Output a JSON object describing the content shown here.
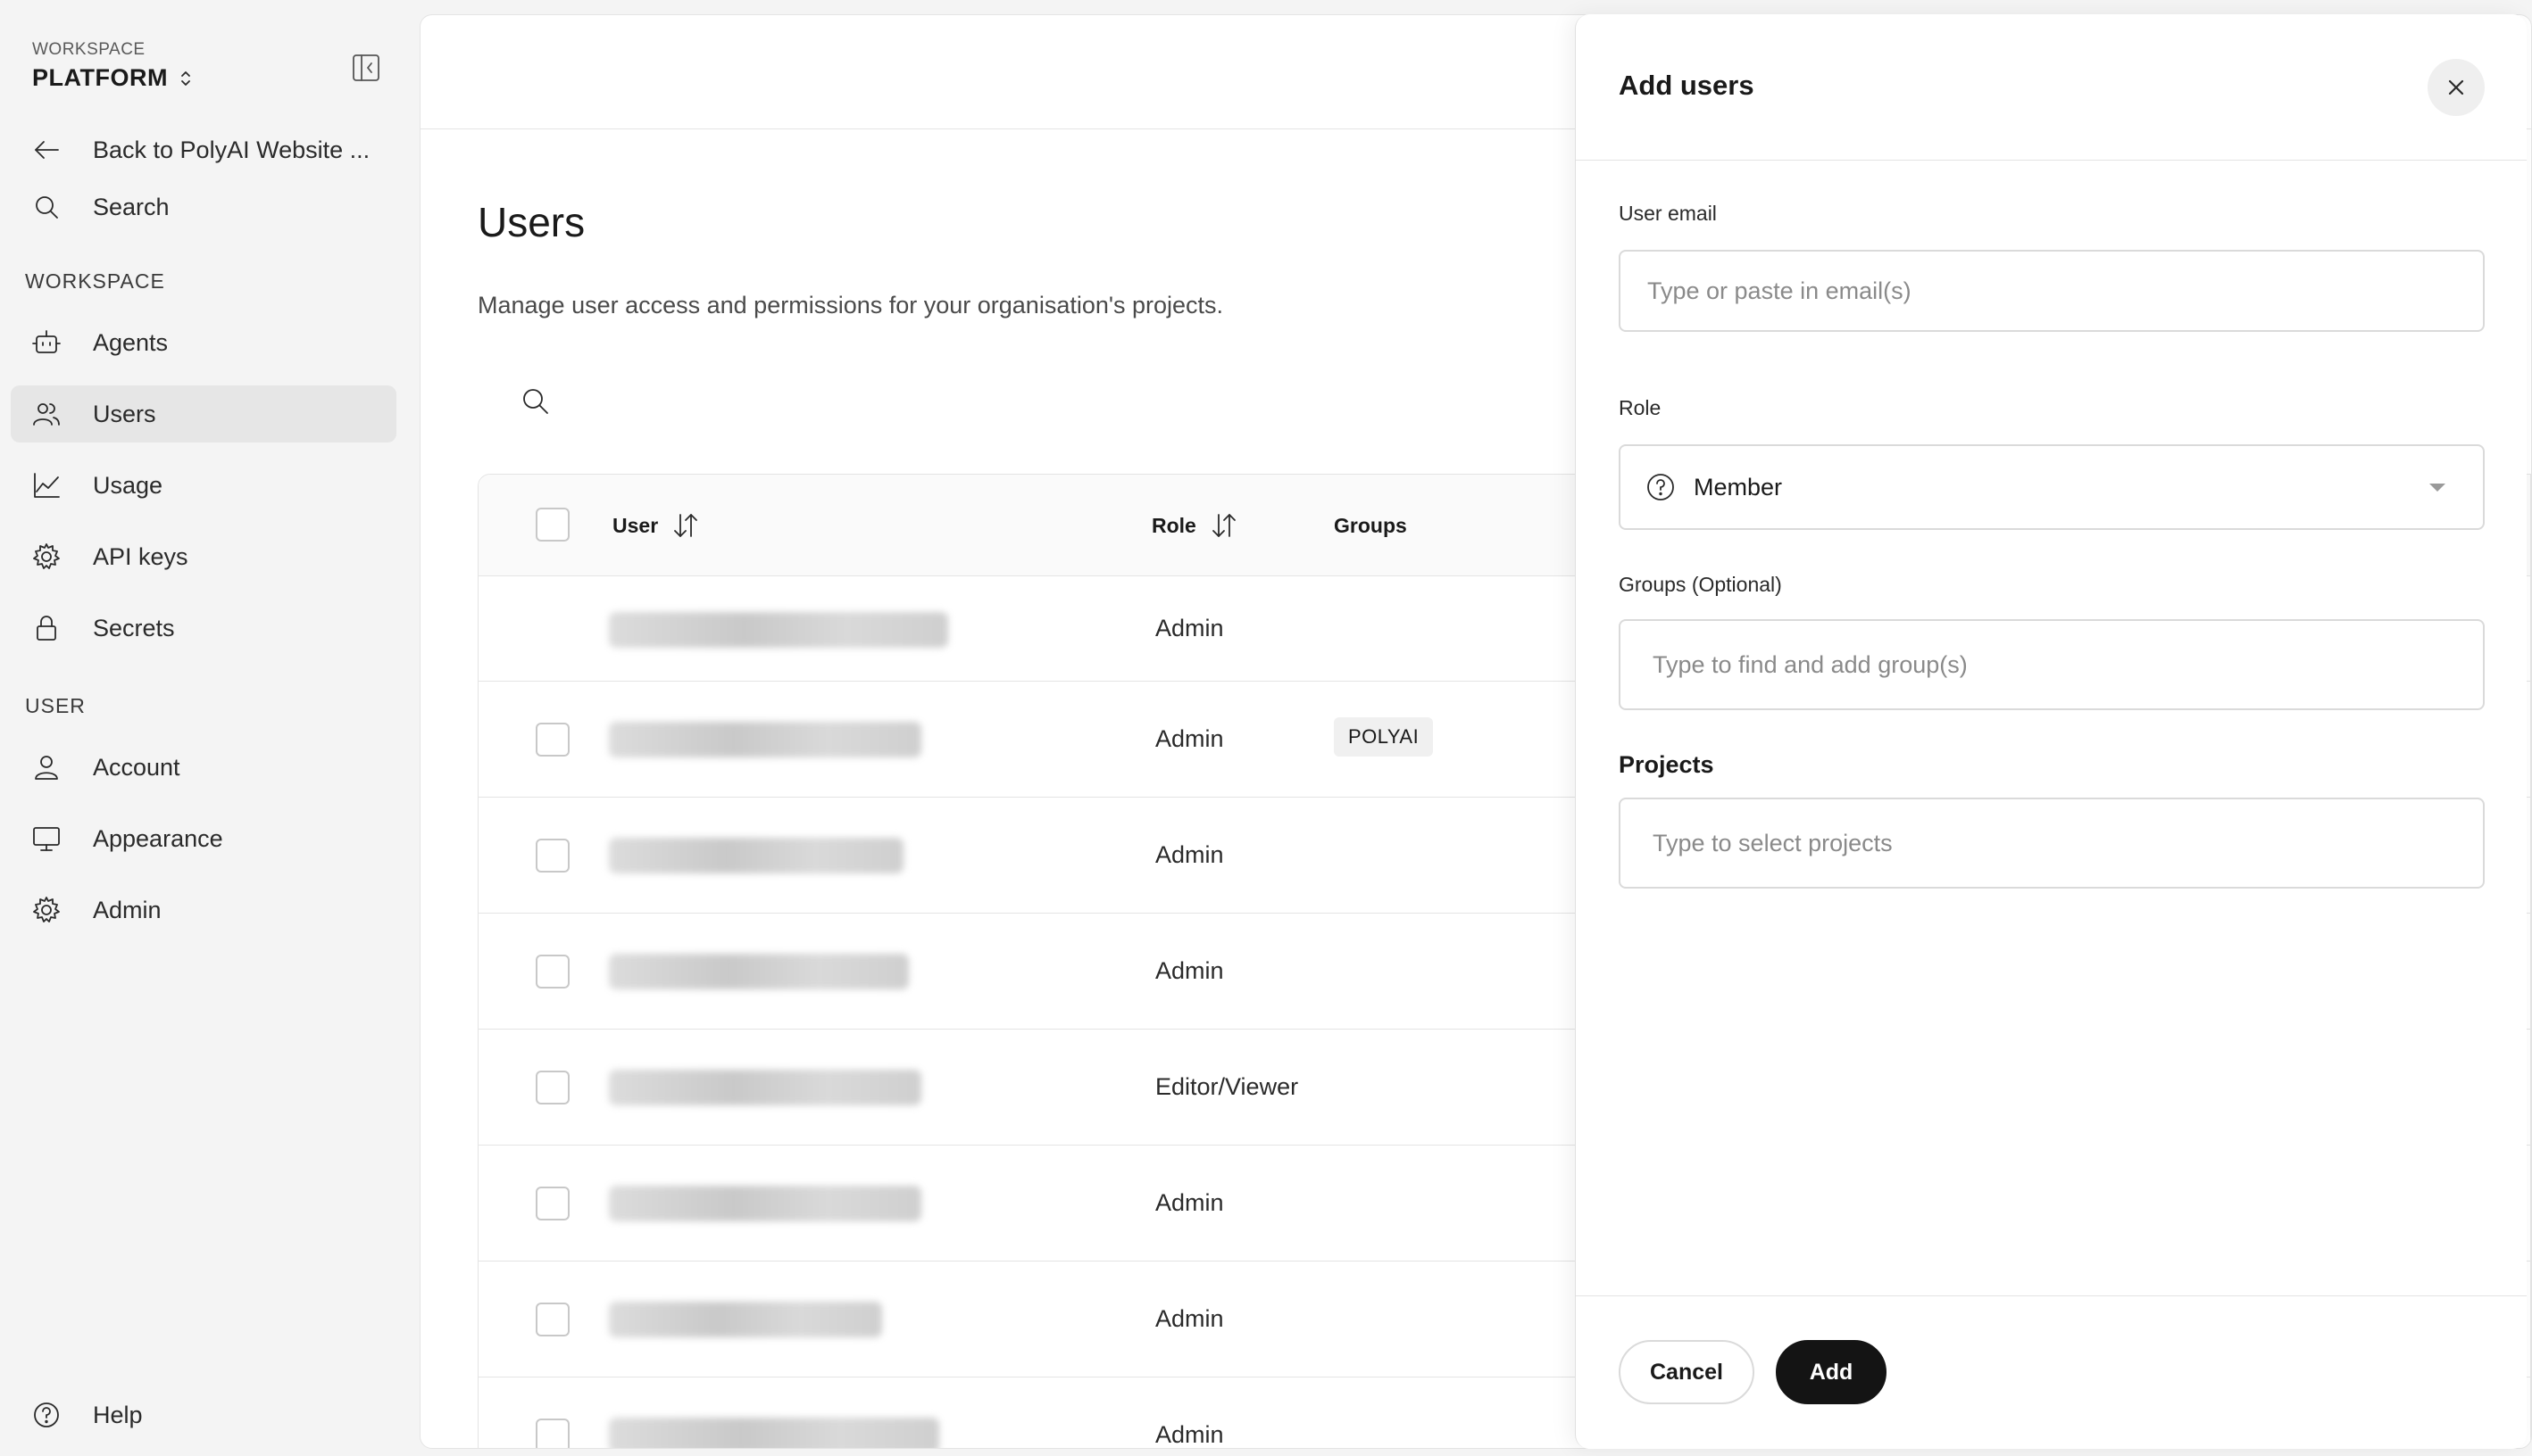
{
  "sidebar": {
    "workspace_label": "WORKSPACE",
    "workspace_name": "PLATFORM",
    "back_label": "Back to PolyAI Website ...",
    "search_label": "Search",
    "section_workspace": "WORKSPACE",
    "section_user": "USER",
    "workspace_items": [
      {
        "label": "Agents",
        "icon": "robot-icon"
      },
      {
        "label": "Users",
        "icon": "users-icon",
        "active": true
      },
      {
        "label": "Usage",
        "icon": "chart-line-icon"
      },
      {
        "label": "API keys",
        "icon": "gear-icon"
      },
      {
        "label": "Secrets",
        "icon": "lock-icon"
      }
    ],
    "user_items": [
      {
        "label": "Account",
        "icon": "person-icon"
      },
      {
        "label": "Appearance",
        "icon": "monitor-icon"
      },
      {
        "label": "Admin",
        "icon": "gear-icon"
      }
    ],
    "help_label": "Help"
  },
  "main": {
    "title": "Users",
    "subtitle": "Manage user access and permissions for your organisation's projects.",
    "table": {
      "columns": {
        "user": "User",
        "role": "Role",
        "groups": "Groups"
      },
      "rows": [
        {
          "role": "Admin",
          "group": ""
        },
        {
          "role": "Admin",
          "group": "POLYAI"
        },
        {
          "role": "Admin",
          "group": ""
        },
        {
          "role": "Admin",
          "group": ""
        },
        {
          "role": "Editor/Viewer",
          "group": ""
        },
        {
          "role": "Admin",
          "group": ""
        },
        {
          "role": "Admin",
          "group": ""
        },
        {
          "role": "Admin",
          "group": ""
        }
      ]
    }
  },
  "drawer": {
    "title": "Add users",
    "email_label": "User email",
    "email_placeholder": "Type or paste in email(s)",
    "role_label": "Role",
    "role_value": "Member",
    "groups_label": "Groups (Optional)",
    "groups_placeholder": "Type to find and add group(s)",
    "projects_label": "Projects",
    "projects_placeholder": "Type to select projects",
    "cancel_label": "Cancel",
    "add_label": "Add"
  },
  "colors": {
    "sidebar_bg": "#f4f4f4",
    "active_item_bg": "#e6e6e6",
    "primary_button": "#141414",
    "border": "#e4e4e4"
  }
}
